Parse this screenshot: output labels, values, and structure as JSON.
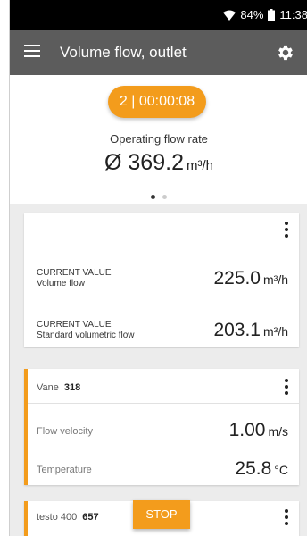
{
  "status_bar": {
    "wifi_icon": "wifi-icon",
    "battery_percent": "84%",
    "battery_icon": "battery-icon",
    "time": "11:38"
  },
  "app_bar": {
    "title": "Volume flow, outlet",
    "menu_icon": "hamburger-menu-icon",
    "settings_icon": "gear-icon"
  },
  "summary": {
    "timer": "2 | 00:00:08",
    "label": "Operating flow rate",
    "value": "Ø 369.2",
    "unit": "m³/h",
    "page_indicator": {
      "pages": 2,
      "active": 1
    }
  },
  "current_values_card": {
    "rows": [
      {
        "caption": "CURRENT VALUE",
        "name": "Volume flow",
        "value": "225.0",
        "unit": "m³/h"
      },
      {
        "caption": "CURRENT VALUE",
        "name": "Standard volumetric flow",
        "value": "203.1",
        "unit": "m³/h"
      }
    ]
  },
  "vane_card": {
    "probe": "Vane",
    "id": "318",
    "rows": [
      {
        "label": "Flow velocity",
        "value": "1.00",
        "unit": "m/s"
      },
      {
        "label": "Temperature",
        "value": "25.8",
        "unit": "°C"
      }
    ]
  },
  "testo_card": {
    "device": "testo 400",
    "id": "657"
  },
  "stop_button": {
    "label": "STOP"
  },
  "colors": {
    "accent": "#f39c1c",
    "app_bar": "#5c5c5c",
    "status_bar": "#000000",
    "list_background": "#ececec"
  }
}
